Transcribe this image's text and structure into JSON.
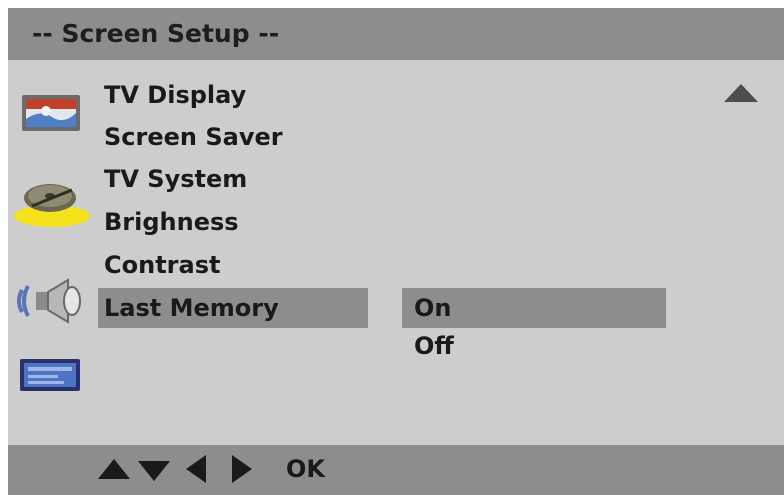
{
  "title": "-- Screen  Setup --",
  "menu": {
    "items": [
      {
        "label": "TV Display"
      },
      {
        "label": "Screen Saver"
      },
      {
        "label": "TV System"
      },
      {
        "label": "Brighness"
      },
      {
        "label": "Contrast"
      },
      {
        "label": "Last Memory",
        "selected": true
      }
    ]
  },
  "options": {
    "items": [
      {
        "label": "On",
        "selected": true
      },
      {
        "label": "Off"
      }
    ]
  },
  "footer": {
    "nav_icons": [
      "up-arrow-icon",
      "down-arrow-icon",
      "left-arrow-icon",
      "right-arrow-icon"
    ],
    "ok_label": "OK"
  },
  "side_icons": [
    "tv-display-icon",
    "disc-icon",
    "audio-speaker-icon",
    "setup-panel-icon"
  ],
  "colors": {
    "background": "#cdcdcd",
    "bar": "#8d8d8d",
    "highlight": "#8d8d8d",
    "text": "#1a1a1a"
  }
}
